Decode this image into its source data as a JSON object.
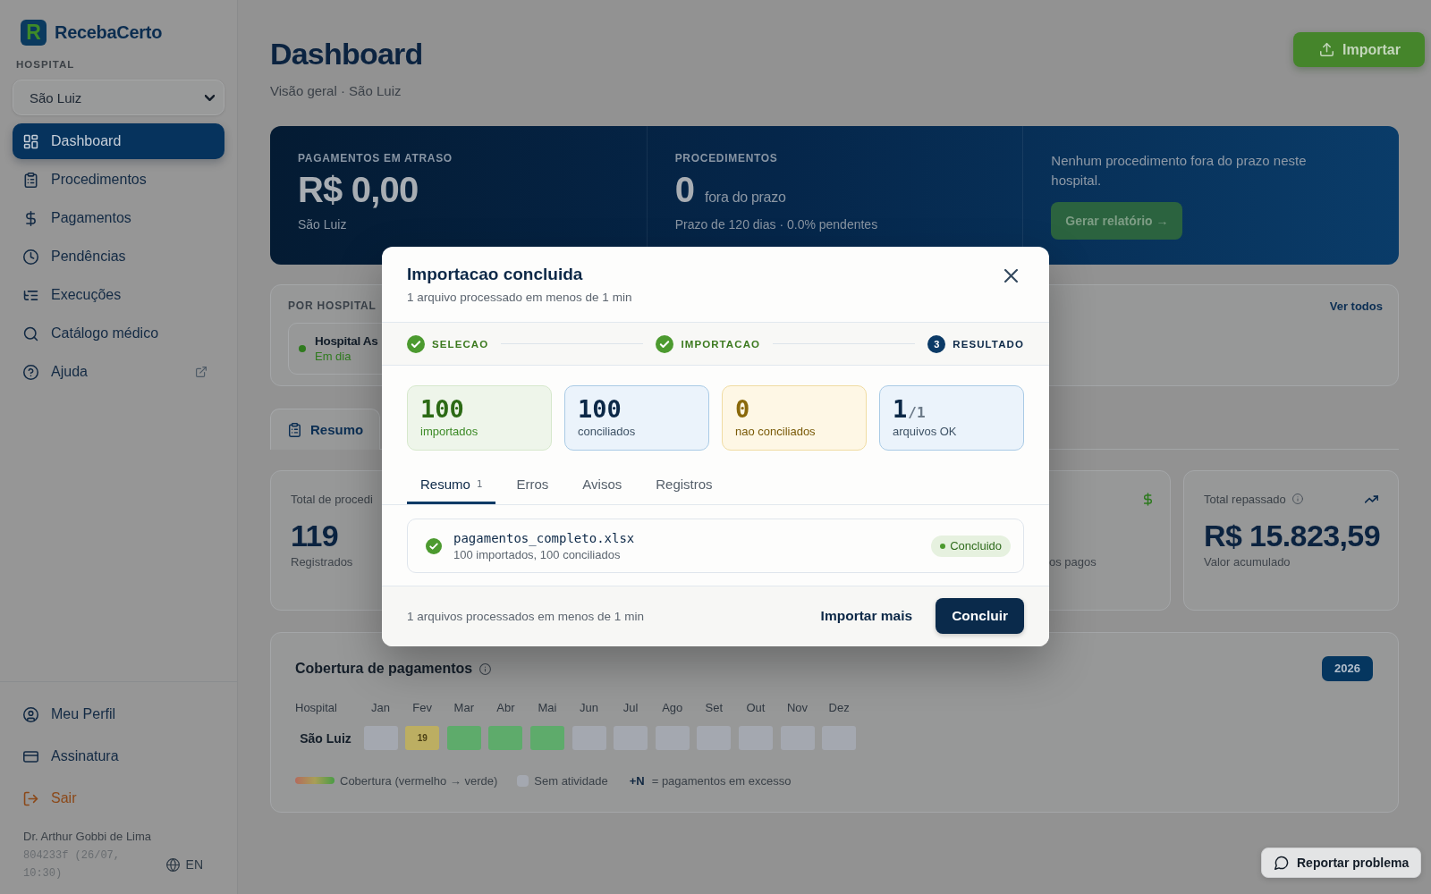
{
  "sidebar": {
    "brand": {
      "logo_letter": "R",
      "name": "RecebaCerto"
    },
    "hospital_label": "HOSPITAL",
    "hospital_select": {
      "value": "São Luiz"
    },
    "nav": [
      {
        "label": "Dashboard",
        "selected": true,
        "external": false
      },
      {
        "label": "Procedimentos",
        "selected": false,
        "external": false
      },
      {
        "label": "Pagamentos",
        "selected": false,
        "external": false
      },
      {
        "label": "Pendências",
        "selected": false,
        "external": false
      },
      {
        "label": "Execuções",
        "selected": false,
        "external": false
      },
      {
        "label": "Catálogo médico",
        "selected": false,
        "external": false
      },
      {
        "label": "Ajuda",
        "selected": false,
        "external": true
      }
    ],
    "account": [
      {
        "label": "Meu Perfil",
        "kind": "normal"
      },
      {
        "label": "Assinatura",
        "kind": "normal"
      },
      {
        "label": "Sair",
        "kind": "danger"
      }
    ],
    "user_name": "Dr. Arthur Gobbi de Lima",
    "build": "804233f (26/07, 10:30)",
    "language": "EN"
  },
  "header": {
    "title": "Dashboard",
    "subtitle": "Visão geral · São Luiz",
    "import_button": "Importar"
  },
  "hero": {
    "overdue": {
      "label": "PAGAMENTOS EM ATRASO",
      "value": "R$ 0,00",
      "note": "São Luiz"
    },
    "procedures": {
      "label": "PROCEDIMENTOS",
      "value": "0",
      "unit": "fora do prazo",
      "note": "Prazo de 120 dias · 0.0% pendentes"
    },
    "message": {
      "text": "Nenhum procedimento fora do prazo neste hospital.",
      "button": "Gerar relatório →"
    }
  },
  "by_hospital": {
    "title": "POR HOSPITAL",
    "link": "Ver todos",
    "items": [
      {
        "name": "Hospital As",
        "status": "Em dia",
        "color": "#2f7a1e"
      }
    ]
  },
  "section_tabs": [
    {
      "label": "Resumo",
      "selected": true
    }
  ],
  "stat_cards": [
    {
      "label": "Total de procedi",
      "value": "119",
      "note": "Registrados",
      "info": false
    },
    {
      "note": "os pagos",
      "info": false
    },
    {
      "label": "Total repassado",
      "value": "R$ 15.823,59",
      "note": "Valor acumulado",
      "info": true
    }
  ],
  "coverage": {
    "title": "Cobertura de pagamentos",
    "year": "2026",
    "row_header": "Hospital",
    "months": [
      "Jan",
      "Fev",
      "Mar",
      "Abr",
      "Mai",
      "Jun",
      "Jul",
      "Ago",
      "Set",
      "Out",
      "Nov",
      "Dez"
    ],
    "rows": [
      {
        "name": "São Luiz",
        "cells": [
          {
            "color": "#a4a8b0"
          },
          {
            "color": "#bcae62",
            "text": "19"
          },
          {
            "color": "#5eab6b"
          },
          {
            "color": "#5eab6b"
          },
          {
            "color": "#5eab6b"
          },
          {
            "color": "#a4a8b0"
          },
          {
            "color": "#a4a8b0"
          },
          {
            "color": "#a4a8b0"
          },
          {
            "color": "#a4a8b0"
          },
          {
            "color": "#a4a8b0"
          },
          {
            "color": "#a4a8b0"
          },
          {
            "color": "#a4a8b0"
          }
        ]
      }
    ],
    "legend": {
      "gradient_label": "Cobertura (vermelho → verde)",
      "empty_label": "Sem atividade",
      "excess_key": "+N",
      "excess_label": "= pagamentos em excesso"
    }
  },
  "report_problem": "Reportar problema",
  "modal": {
    "title": "Importacao concluida",
    "subtitle": "1 arquivo processado em menos de 1 min",
    "steps": [
      {
        "label": "SELECAO",
        "done": true
      },
      {
        "label": "IMPORTACAO",
        "done": true
      },
      {
        "label": "RESULTADO",
        "done": false,
        "number": "3"
      }
    ],
    "stats": [
      {
        "kind": "success",
        "value": "100",
        "label": "importados"
      },
      {
        "kind": "info",
        "value": "100",
        "label": "conciliados"
      },
      {
        "kind": "warning",
        "value": "0",
        "label": "nao conciliados"
      },
      {
        "kind": "info",
        "value": "1",
        "total": "/1",
        "label": "arquivos OK"
      }
    ],
    "tabs": [
      {
        "label": "Resumo",
        "count": "1",
        "selected": true
      },
      {
        "label": "Erros",
        "selected": false
      },
      {
        "label": "Avisos",
        "selected": false
      },
      {
        "label": "Registros",
        "selected": false
      }
    ],
    "files": [
      {
        "name": "pagamentos_completo.xlsx",
        "detail": "100 importados, 100 conciliados",
        "status": "Concluido",
        "kind": "success"
      }
    ],
    "footer": {
      "note": "1 arquivos processados em menos de 1 min",
      "secondary_button": "Importar mais",
      "primary_button": "Concluir"
    }
  }
}
